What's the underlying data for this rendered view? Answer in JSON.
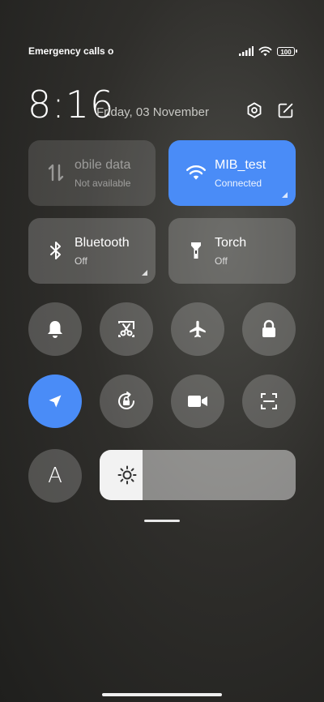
{
  "status": {
    "carrier_text": "Emergency calls o",
    "battery": "100"
  },
  "header": {
    "time": "8:16",
    "date": "Friday, 03 November"
  },
  "tiles": [
    {
      "title": "obile data",
      "subtitle": "Not available",
      "icon": "mobile-data-icon",
      "state": "disabled"
    },
    {
      "title": "MIB_test",
      "subtitle": "Connected",
      "icon": "wifi-icon",
      "state": "active"
    },
    {
      "title": "Bluetooth",
      "subtitle": "Off",
      "icon": "bluetooth-icon",
      "state": "off"
    },
    {
      "title": "Torch",
      "subtitle": "Off",
      "icon": "torch-icon",
      "state": "off"
    }
  ],
  "toggles": [
    {
      "icon": "bell-icon",
      "state": "off"
    },
    {
      "icon": "screenshot-icon",
      "state": "off"
    },
    {
      "icon": "airplane-icon",
      "state": "off"
    },
    {
      "icon": "lock-icon",
      "state": "off"
    },
    {
      "icon": "location-icon",
      "state": "on"
    },
    {
      "icon": "rotation-lock-icon",
      "state": "off"
    },
    {
      "icon": "video-camera-icon",
      "state": "off"
    },
    {
      "icon": "scan-icon",
      "state": "off"
    }
  ],
  "brightness": {
    "auto_label": "A",
    "level": 0.22
  },
  "colors": {
    "accent": "#4a8cf7",
    "tile_bg": "rgba(255,255,255,0.2)"
  }
}
